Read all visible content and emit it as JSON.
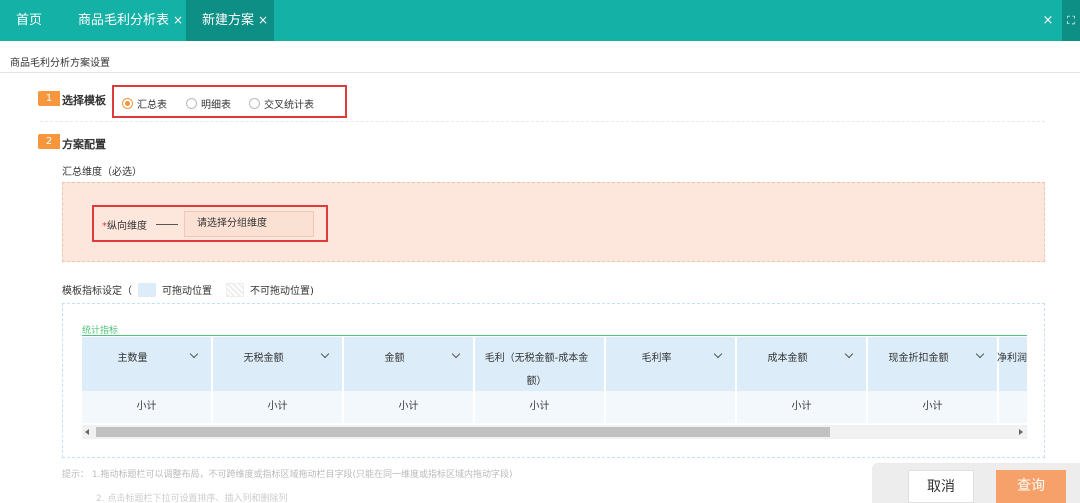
{
  "tabs": {
    "home": "首页",
    "tab1": "商品毛利分析表",
    "tab2": "新建方案",
    "close_glyph": "×"
  },
  "page_title": "商品毛利分析方案设置",
  "step1": {
    "num": "1",
    "label": "选择模板",
    "options": [
      {
        "label": "汇总表",
        "selected": true
      },
      {
        "label": "明细表",
        "selected": false
      },
      {
        "label": "交叉统计表",
        "selected": false
      }
    ]
  },
  "step2": {
    "num": "2",
    "label": "方案配置",
    "summary_label": "汇总维度（必选）",
    "required_mark": "*",
    "vertical_dim_label": "纵向维度",
    "dim_placeholder": "请选择分组维度"
  },
  "indicators": {
    "prefix": "模板指标设定（",
    "draggable": "可拖动位置",
    "not_draggable": "不可拖动位置)",
    "section_title": "统计指标",
    "columns": [
      {
        "header": "主数量",
        "value": "小计",
        "chevron": true
      },
      {
        "header": "无税金额",
        "value": "小计",
        "chevron": true
      },
      {
        "header": "金额",
        "value": "小计",
        "chevron": true
      },
      {
        "header": "毛利（无税金额-成本金额）",
        "value": "小计",
        "chevron": false
      },
      {
        "header": "毛利率",
        "value": "",
        "chevron": true
      },
      {
        "header": "成本金额",
        "value": "小计",
        "chevron": true
      },
      {
        "header": "现金折扣金额",
        "value": "小计",
        "chevron": true
      },
      {
        "header": "净利润",
        "value": "",
        "chevron": false
      }
    ]
  },
  "tips": {
    "line1": "提示：  1.拖动标题栏可以调整布局，不可跨维度或指标区域拖动栏目字段(只能在同一维度或指标区域内拖动字段)",
    "line2": "2. 点击标题栏下拉可设置排序、插入列和删除列"
  },
  "buttons": {
    "cancel": "取消",
    "query": "查询"
  },
  "colors": {
    "header_teal": "#13b1a6",
    "accent_orange": "#f6973e",
    "highlight_red": "#e03b3b"
  }
}
